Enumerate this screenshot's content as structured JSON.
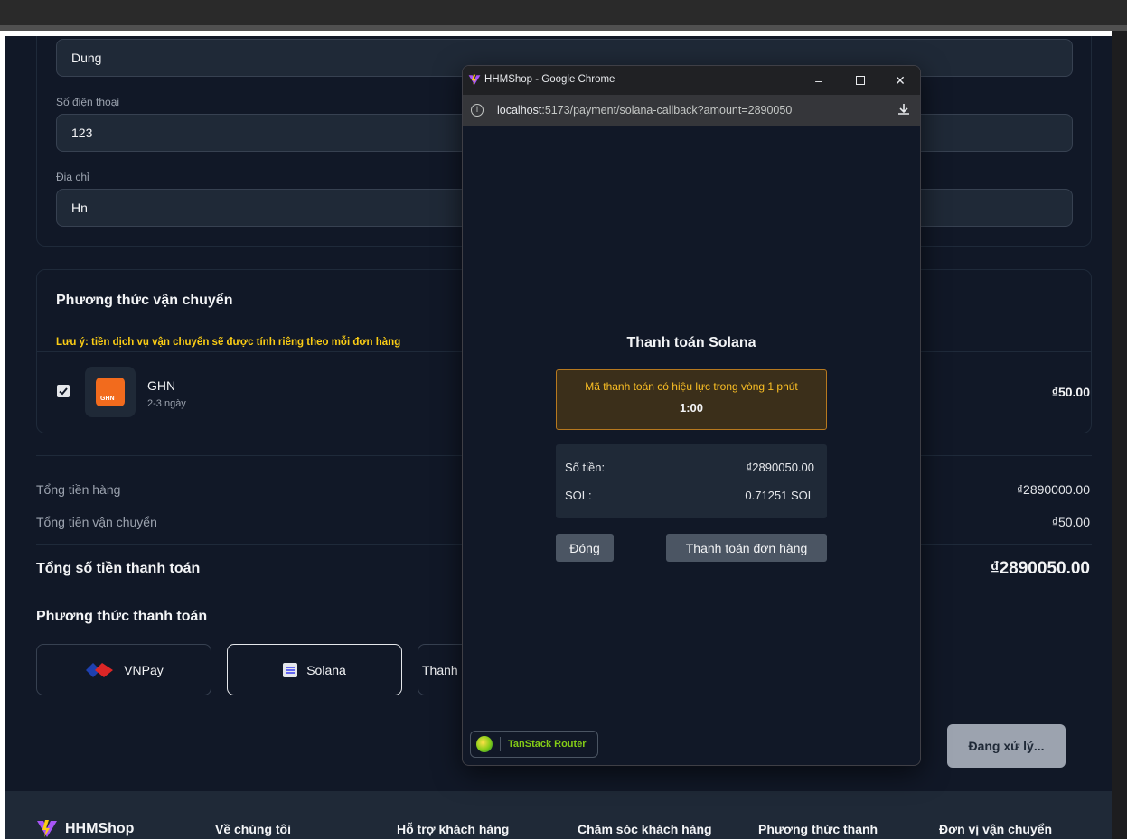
{
  "customer": {
    "name_value": "Dung",
    "phone_label": "Số điện thoại",
    "phone_value": "123",
    "address_label": "Địa chỉ",
    "address_value": "Hn"
  },
  "shipping": {
    "title": "Phương thức vận chuyển",
    "note": "Lưu ý: tiền dịch vụ vận chuyển sẽ được tính riêng theo mỗi đơn hàng",
    "carrier": {
      "name": "GHN",
      "eta": "2-3 ngày",
      "price": "₫50.00",
      "logo_text": "GHN",
      "checked": true
    }
  },
  "totals": {
    "items_label": "Tổng tiền hàng",
    "items_value": "₫2890000.00",
    "shipping_label": "Tổng tiền vận chuyển",
    "shipping_value": "₫50.00",
    "grand_label": "Tổng số tiền thanh toán",
    "grand_value": "₫2890050.00"
  },
  "payment": {
    "title": "Phương thức thanh toán",
    "options": [
      {
        "label": "VNPay",
        "selected": false
      },
      {
        "label": "Solana",
        "selected": true
      },
      {
        "label": "Thanh",
        "selected": false
      }
    ],
    "submit_label": "Đang xử lý..."
  },
  "footer": {
    "brand": "HHMShop",
    "links": [
      "Về chúng tôi",
      "Hỗ trợ khách hàng",
      "Chăm sóc khách hàng",
      "Phương thức thanh",
      "Đơn vị vận chuyển"
    ]
  },
  "popup": {
    "window_title": "HHMShop - Google Chrome",
    "url_host": "localhost",
    "url_rest": ":5173/payment/solana-callback?amount=2890050",
    "heading": "Thanh toán Solana",
    "timer_message": "Mã thanh toán có hiệu lực trong vòng 1 phút",
    "timer_value": "1:00",
    "amount_label": "Số tiền:",
    "amount_value": "₫2890050.00",
    "sol_label": "SOL:",
    "sol_value": "0.71251 SOL",
    "close_button": "Đóng",
    "pay_button": "Thanh toán đơn hàng",
    "devtools_label": "TanStack Router"
  },
  "colors": {
    "page_bg": "#111827",
    "warning": "#facc15",
    "ghn_brand": "#f26b1d",
    "tanstack": "#84cc16"
  }
}
